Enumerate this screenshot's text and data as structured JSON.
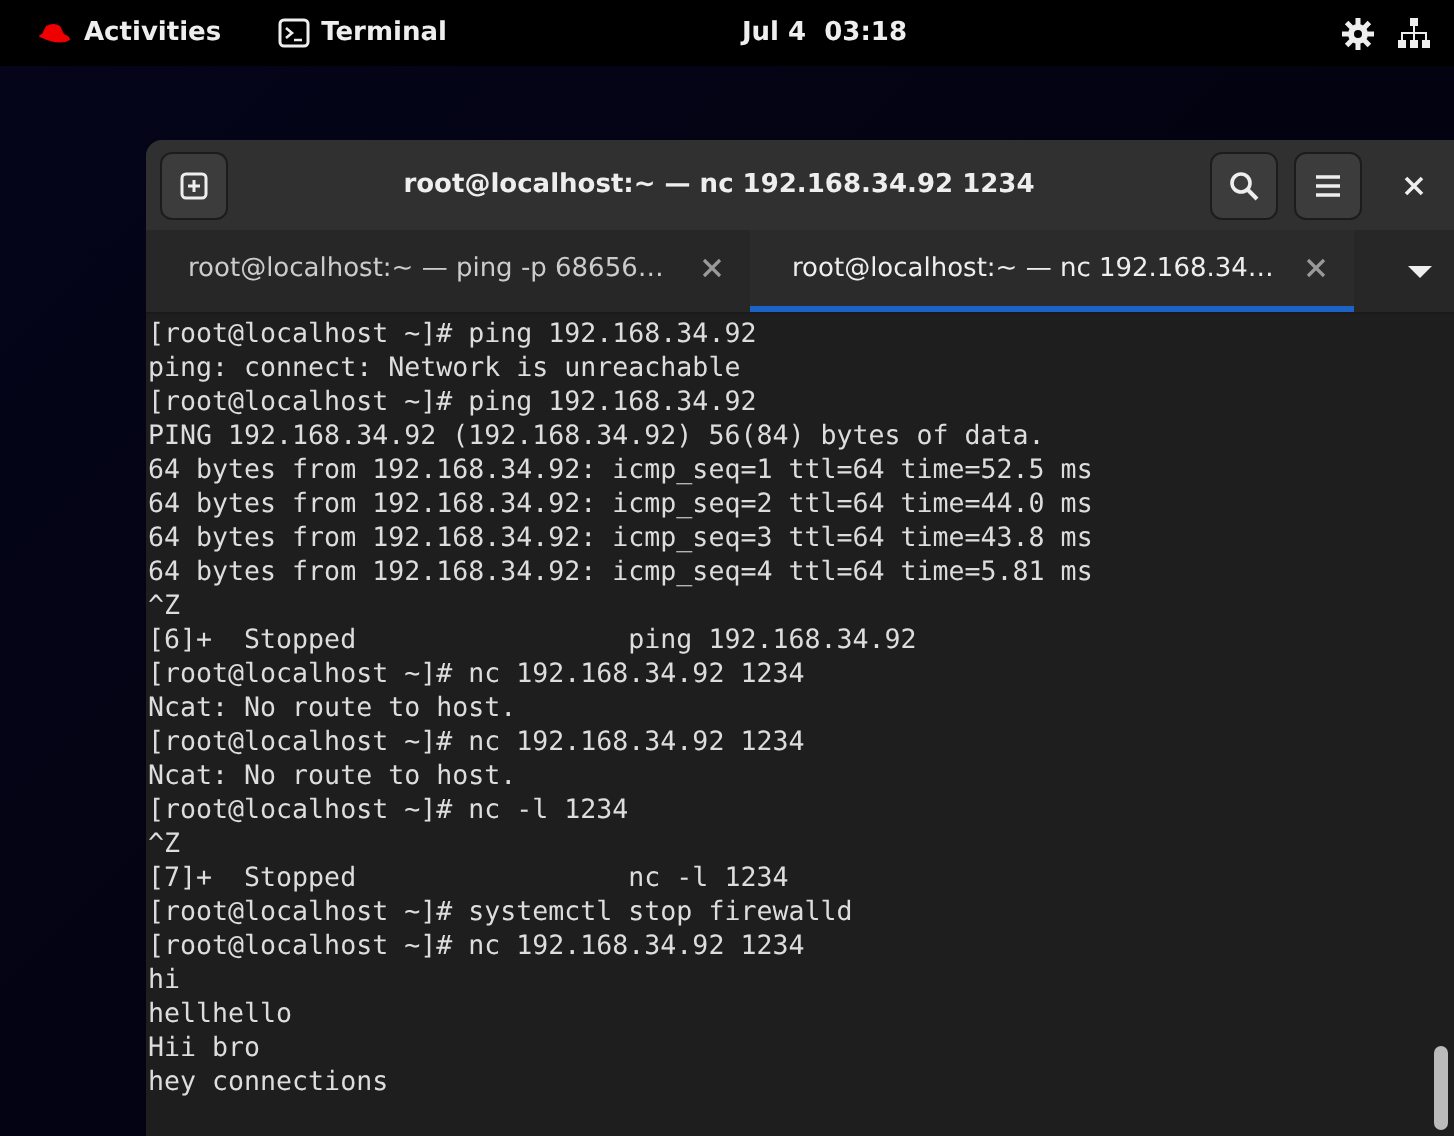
{
  "top_bar": {
    "activities": "Activities",
    "app": "Terminal",
    "clock": "Jul 4  03:18"
  },
  "window": {
    "title": "root@localhost:~ — nc 192.168.34.92 1234"
  },
  "tabs": [
    {
      "label": "root@localhost:~ — ping -p 68656…",
      "selected": false
    },
    {
      "label": "root@localhost:~ — nc 192.168.34…",
      "selected": true
    }
  ],
  "terminal": {
    "lines": [
      "[root@localhost ~]# ping 192.168.34.92",
      "ping: connect: Network is unreachable",
      "[root@localhost ~]# ping 192.168.34.92",
      "PING 192.168.34.92 (192.168.34.92) 56(84) bytes of data.",
      "64 bytes from 192.168.34.92: icmp_seq=1 ttl=64 time=52.5 ms",
      "64 bytes from 192.168.34.92: icmp_seq=2 ttl=64 time=44.0 ms",
      "64 bytes from 192.168.34.92: icmp_seq=3 ttl=64 time=43.8 ms",
      "64 bytes from 192.168.34.92: icmp_seq=4 ttl=64 time=5.81 ms",
      "^Z",
      "[6]+  Stopped                 ping 192.168.34.92",
      "[root@localhost ~]# nc 192.168.34.92 1234",
      "Ncat: No route to host.",
      "[root@localhost ~]# nc 192.168.34.92 1234",
      "Ncat: No route to host.",
      "[root@localhost ~]# nc -l 1234",
      "^Z",
      "[7]+  Stopped                 nc -l 1234",
      "[root@localhost ~]# systemctl stop firewalld",
      "[root@localhost ~]# nc 192.168.34.92 1234",
      "hi",
      "hellhello",
      "Hii bro",
      "hey connections"
    ]
  }
}
